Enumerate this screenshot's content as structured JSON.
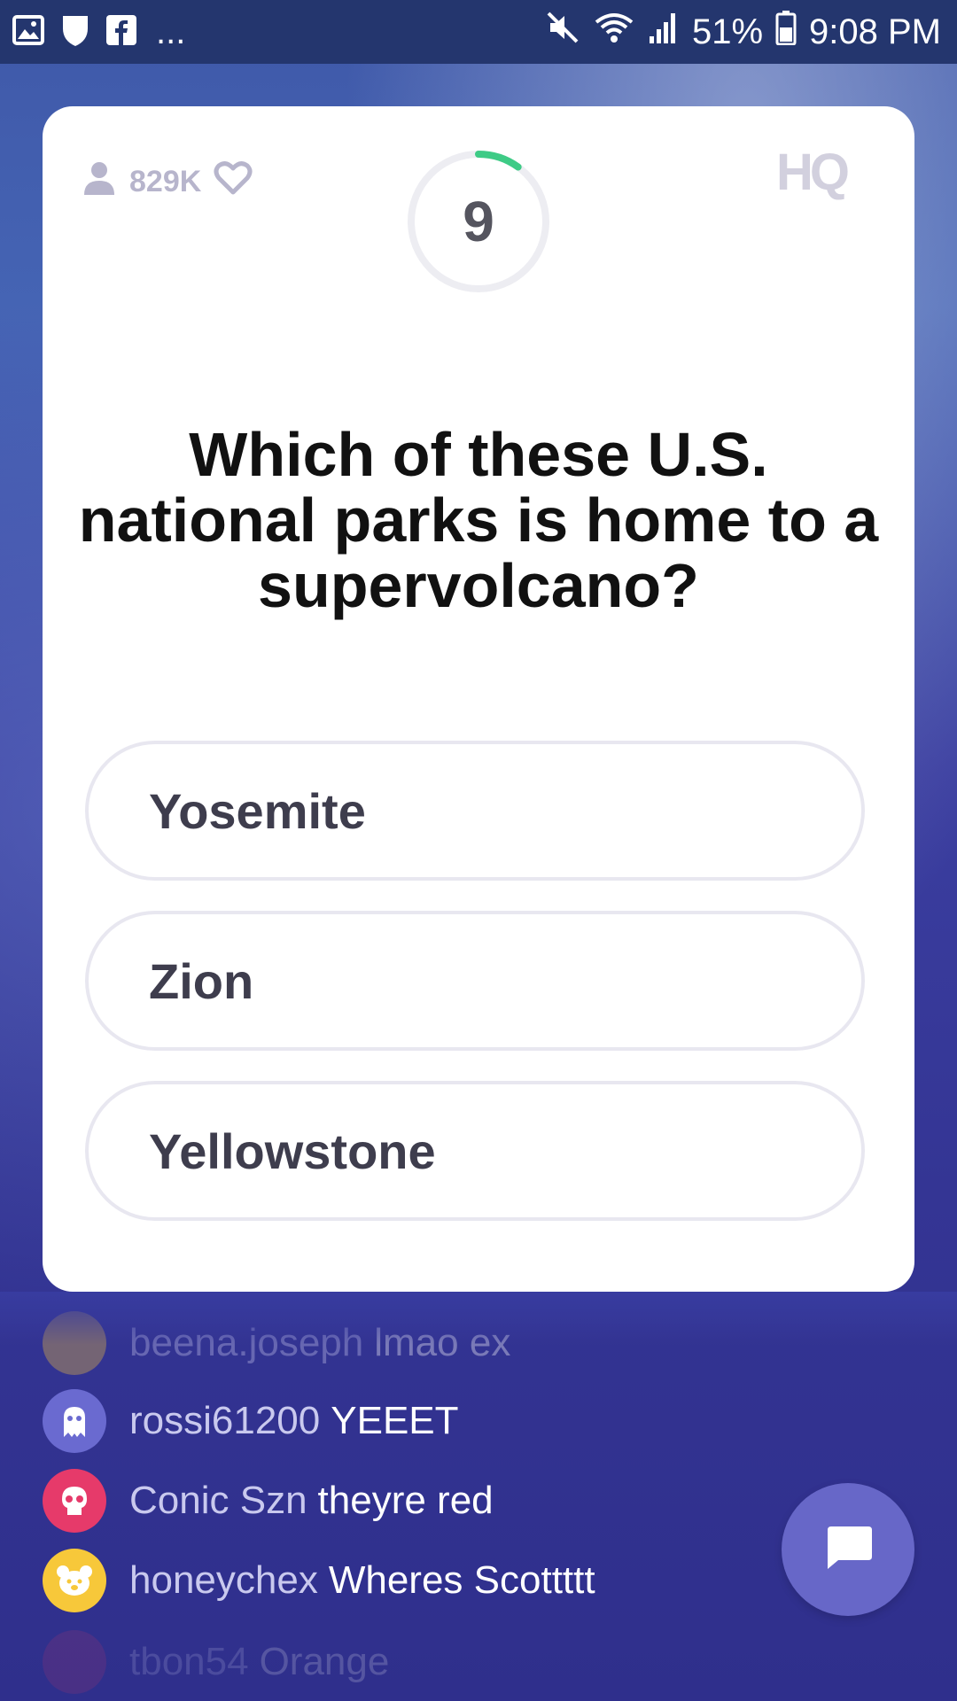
{
  "status_bar": {
    "battery": "51%",
    "time": "9:08 PM",
    "left_icons": [
      "gallery-icon",
      "shield-icon",
      "facebook-icon",
      "more-dots"
    ],
    "right_icons": [
      "mute-icon",
      "wifi-icon",
      "signal-icon",
      "battery-icon"
    ],
    "more": "..."
  },
  "card": {
    "viewers": "829K",
    "timer_value": "9",
    "timer_progress": 0.1,
    "logo": "HQ",
    "question": "Which of these U.S. national parks is home to a supervolcano?",
    "answers": [
      "Yosemite",
      "Zion",
      "Yellowstone"
    ]
  },
  "chat": {
    "messages": [
      {
        "user": "beena.joseph",
        "text": "lmao ex",
        "avatar_color": "#f2c040"
      },
      {
        "user": "rossi61200",
        "text": "YEEET",
        "avatar_color": "#6a6ad0"
      },
      {
        "user": "Conic Szn",
        "text": "theyre red",
        "avatar_color": "#e63a6a"
      },
      {
        "user": "honeychex",
        "text": "Wheres Scottttt",
        "avatar_color": "#f7c83a"
      },
      {
        "user": "tbon54",
        "text": "Orange",
        "avatar_color": "#c2356a"
      }
    ]
  },
  "colors": {
    "accent_green": "#3ecb86",
    "card_bg": "#ffffff",
    "chat_button": "#6767c8"
  }
}
